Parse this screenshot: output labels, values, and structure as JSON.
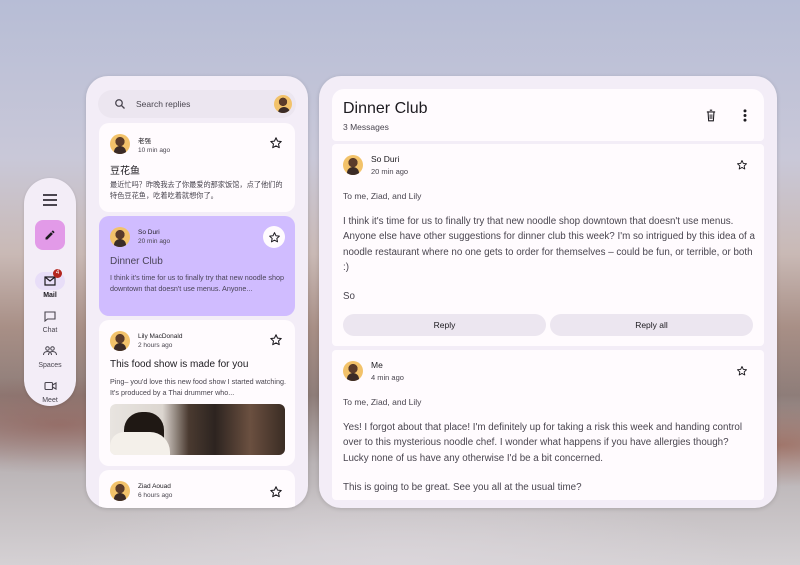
{
  "rail": {
    "items": [
      {
        "label": "Mail",
        "badge": "4"
      },
      {
        "label": "Chat"
      },
      {
        "label": "Spaces"
      },
      {
        "label": "Meet"
      }
    ]
  },
  "search": {
    "placeholder": "Search replies"
  },
  "list": [
    {
      "name": "老强",
      "time": "10 min ago",
      "subject": "豆花鱼",
      "preview": "最近忙吗？昨晚我去了你最爱的那家饭馆，点了他们的特色豆花鱼，吃着吃着就想你了。"
    },
    {
      "name": "So Duri",
      "time": "20 min ago",
      "subject": "Dinner Club",
      "preview": "I think it's time for us to finally try that new noodle shop downtown that doesn't use menus. Anyone..."
    },
    {
      "name": "Lily MacDonald",
      "time": "2 hours ago",
      "subject": "This food show is made for you",
      "preview": "Ping– you'd love this new food show I started watching. It's produced by a Thai drummer who..."
    },
    {
      "name": "Ziad Aouad",
      "time": "6 hours ago"
    }
  ],
  "thread": {
    "title": "Dinner Club",
    "count": "3 Messages",
    "messages": [
      {
        "name": "So Duri",
        "time": "20 min ago",
        "to": "To me, Ziad, and Lily",
        "body": "I think it's time for us to finally try that new noodle shop downtown that doesn't use menus. Anyone else have other suggestions for dinner club this week? I'm so intrigued by this idea of a noodle restaurant where no one gets to order for themselves – could be fun, or terrible, or both :)",
        "signoff": "So",
        "reply": "Reply",
        "reply_all": "Reply all"
      },
      {
        "name": "Me",
        "time": "4 min ago",
        "to": "To me, Ziad, and Lily",
        "body": "Yes! I forgot about that place! I'm definitely up for taking a risk this week and handing control over to this mysterious noodle chef. I wonder what happens if you have allergies though? Lucky none of us have any otherwise I'd be a bit concerned.",
        "body2": "This is going to be great. See you all at the usual time?"
      }
    ]
  }
}
